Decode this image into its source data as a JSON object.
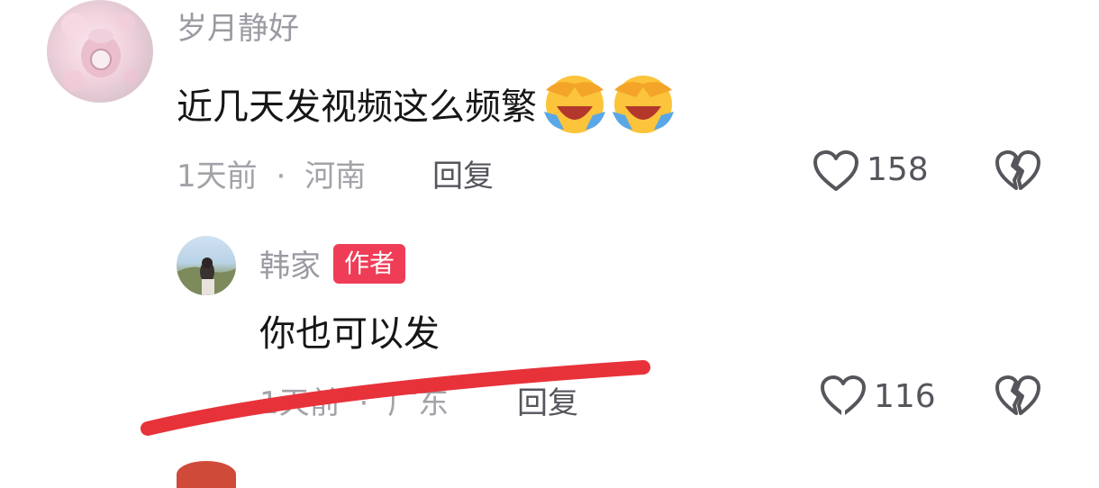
{
  "comment1": {
    "username": "岁月静好",
    "text": "近几天发视频这么频繁",
    "emojis": [
      "laugh-cry-emoji",
      "laugh-cry-emoji"
    ],
    "time": "1天前",
    "separator": "·",
    "location": "河南",
    "reply_label": "回复",
    "like_count": "158"
  },
  "reply1": {
    "username": "韩家",
    "badge": "作者",
    "text": "你也可以发",
    "time": "1天前",
    "separator": "·",
    "location": "广东",
    "reply_label": "回复",
    "like_count": "116"
  },
  "colors": {
    "badge_bg": "#ef3d57",
    "strike_red": "#e8323a",
    "meta_gray": "#a2a2a8"
  },
  "icons": [
    "heart-outline-icon",
    "broken-heart-icon"
  ]
}
